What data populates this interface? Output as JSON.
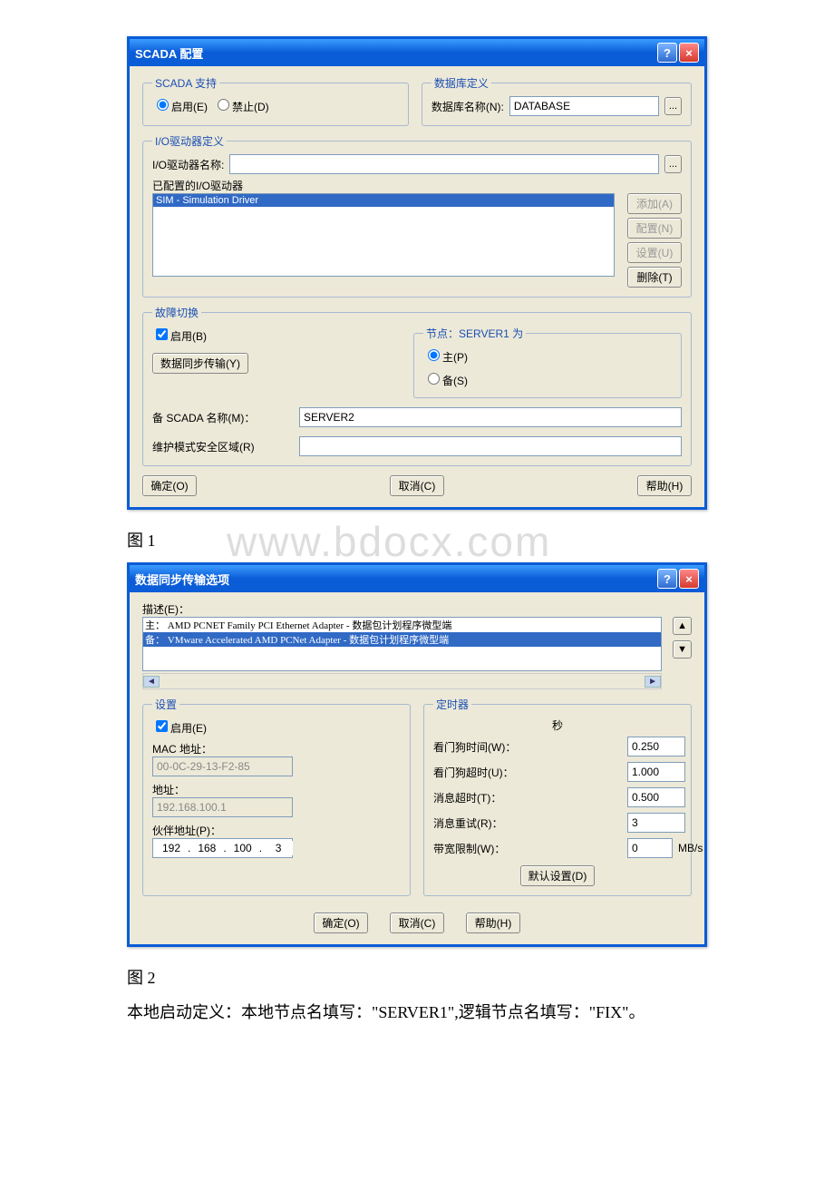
{
  "dialog1": {
    "title": "SCADA 配置",
    "scada_support": {
      "legend": "SCADA 支持",
      "enable": "启用(E)",
      "disable": "禁止(D)"
    },
    "db_def": {
      "legend": "数据库定义",
      "label": "数据库名称(N):",
      "value": "DATABASE",
      "browse": "..."
    },
    "io_def": {
      "legend": "I/O驱动器定义",
      "name_label": "I/O驱动器名称:",
      "name_value": "",
      "browse": "...",
      "configured_label": "已配置的I/O驱动器",
      "item": "SIM - Simulation Driver",
      "add": "添加(A)",
      "config": "配置(N)",
      "setup": "设置(U)",
      "delete": "删除(T)"
    },
    "failover": {
      "legend": "故障切换",
      "enable": "启用(B)",
      "sync": "数据同步传输(Y)",
      "node_group": "节点：SERVER1 为",
      "primary": "主(P)",
      "backup": "备(S)",
      "backup_name_label": "备 SCADA 名称(M)：",
      "backup_name_value": "SERVER2",
      "maint_label": "维护模式安全区域(R)",
      "maint_value": ""
    },
    "buttons": {
      "ok": "确定(O)",
      "cancel": "取消(C)",
      "help": "帮助(H)"
    }
  },
  "caption1": "图 1",
  "watermark": "www.bdocx.com",
  "dialog2": {
    "title": "数据同步传输选项",
    "desc_label": "描述(E)：",
    "line_main_prefix": "主：",
    "line_main": "AMD PCNET Family PCI Ethernet Adapter - 数据包计划程序微型端",
    "line_bak_prefix": "备：",
    "line_bak": "VMware Accelerated AMD PCNet Adapter - 数据包计划程序微型端",
    "settings": {
      "legend": "设置",
      "enable": "启用(E)",
      "mac_label": "MAC 地址：",
      "mac_value": "00-0C-29-13-F2-85",
      "addr_label": "地址：",
      "addr_value": "192.168.100.1",
      "partner_label": "伙伴地址(P)：",
      "ip": {
        "a": "192",
        "b": "168",
        "c": "100",
        "d": "3"
      }
    },
    "timer": {
      "legend": "定时器",
      "unit": "秒",
      "watchdog_time": "看门狗时间(W)：",
      "watchdog_time_v": "0.250",
      "watchdog_timeout": "看门狗超时(U)：",
      "watchdog_timeout_v": "1.000",
      "msg_timeout": "消息超时(T)：",
      "msg_timeout_v": "0.500",
      "msg_retry": "消息重试(R)：",
      "msg_retry_v": "3",
      "bandwidth": "带宽限制(W)：",
      "bandwidth_v": "0",
      "bandwidth_unit": "MB/s",
      "defaults": "默认设置(D)"
    },
    "buttons": {
      "ok": "确定(O)",
      "cancel": "取消(C)",
      "help": "帮助(H)"
    }
  },
  "caption2": "图 2",
  "body_text": "本地启动定义：本地节点名填写：\"SERVER1\",逻辑节点名填写：\"FIX\"。"
}
